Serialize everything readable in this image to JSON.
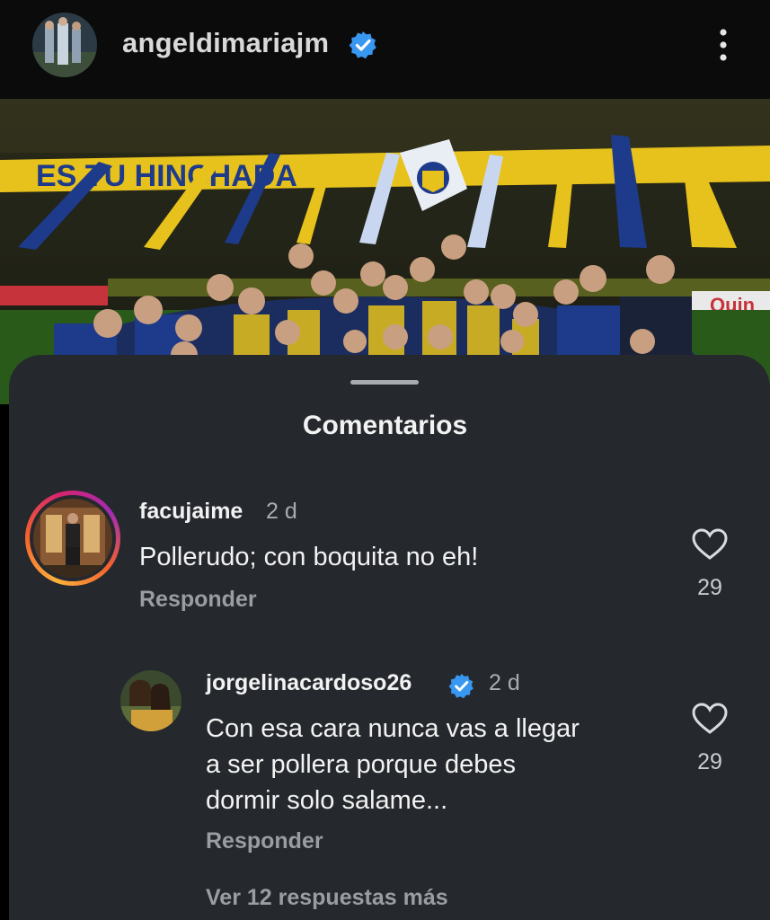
{
  "post": {
    "username": "angeldimariajm",
    "verified": true,
    "colors": {
      "verified": "#3897f0",
      "background": "#000000"
    }
  },
  "photo": {
    "description_icon": "team-celebration-photo",
    "banner_text": "ES TU HINCHADA",
    "ad_text": "Quin",
    "colors": {
      "yellow": "#e7c21c",
      "blue": "#1e3a8a"
    }
  },
  "comments_sheet": {
    "title": "Comentarios",
    "comments": [
      {
        "username": "facujaime",
        "time": "2 d",
        "text": "Pollerudo; con boquita no eh!",
        "reply_label": "Responder",
        "likes": "29",
        "has_story_ring": true
      },
      {
        "username": "jorgelinacardoso26",
        "verified": true,
        "time": "2 d",
        "text_lines": [
          "Con esa cara nunca vas a llegar",
          "a ser pollera porque debes",
          "dormir solo salame..."
        ],
        "reply_label": "Responder",
        "likes": "29",
        "view_more": "Ver 12 respuestas más"
      }
    ],
    "colors": {
      "sheet": "#25282d",
      "muted": "#9a9da2"
    }
  }
}
